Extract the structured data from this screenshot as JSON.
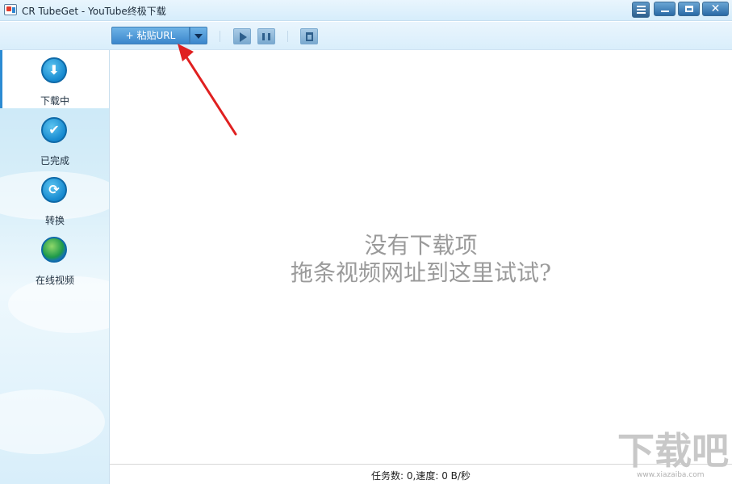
{
  "window": {
    "title": "CR TubeGet - YouTube终极下载"
  },
  "toolbar": {
    "paste_label": "+ 粘贴URL"
  },
  "sidebar": {
    "items": [
      {
        "label": "下载中",
        "icon": "download-icon",
        "glyph": "⬇",
        "active": true
      },
      {
        "label": "已完成",
        "icon": "check-icon",
        "glyph": "✔",
        "active": false
      },
      {
        "label": "转换",
        "icon": "convert-icon",
        "glyph": "⟳",
        "active": false
      },
      {
        "label": "在线视频",
        "icon": "globe-icon",
        "glyph": "",
        "active": false
      }
    ]
  },
  "main": {
    "empty_title": "没有下载项",
    "empty_hint": "拖条视频网址到这里试试?"
  },
  "status": {
    "text": "任务数: 0,速度: 0 B/秒"
  },
  "watermark": {
    "chars": [
      "下",
      "载",
      "吧"
    ],
    "url": "www.xiazaiba.com"
  },
  "colors": {
    "accent": "#2c8bd3",
    "annotation_arrow": "#e02020",
    "empty_text": "#9a9a9a"
  }
}
